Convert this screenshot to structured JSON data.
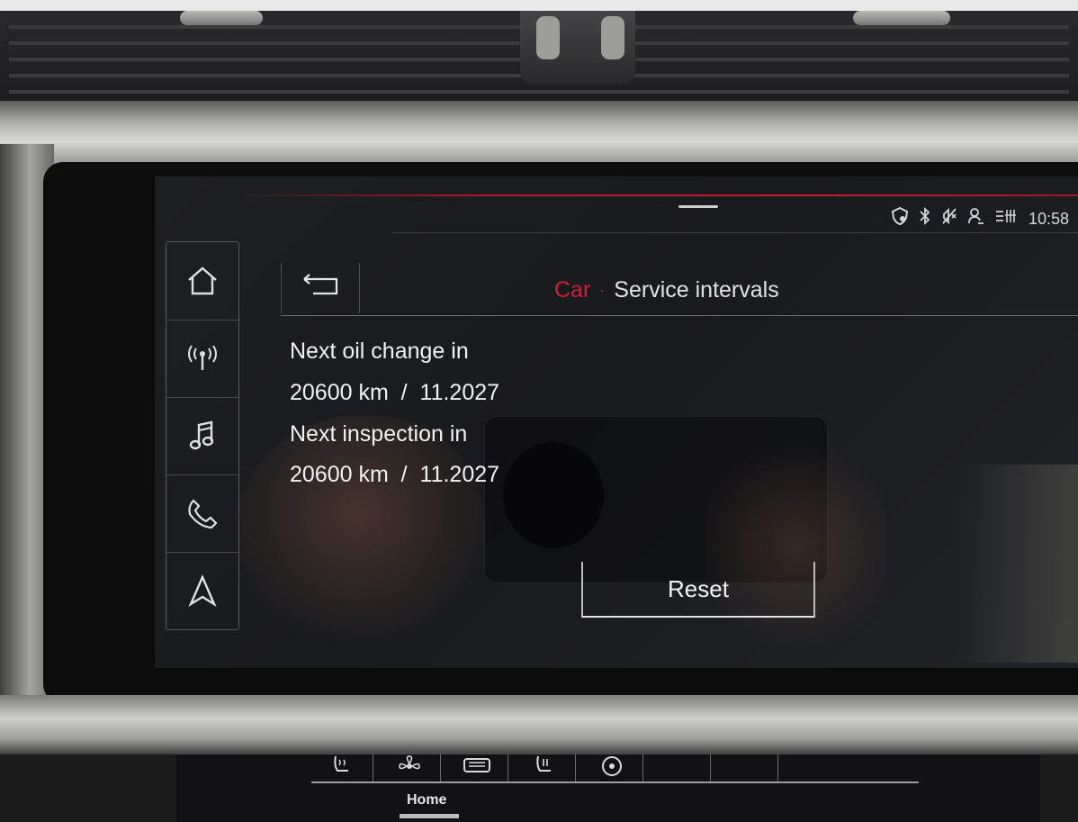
{
  "status_bar": {
    "time": "10:58",
    "icons": [
      "shield-icon",
      "bluetooth-icon",
      "muted-notification-icon",
      "user-profile-icon",
      "signal-settings-icon"
    ]
  },
  "nav_rail": {
    "items": [
      {
        "icon": "home-icon"
      },
      {
        "icon": "radio-antenna-icon"
      },
      {
        "icon": "music-note-icon"
      },
      {
        "icon": "phone-icon"
      },
      {
        "icon": "navigation-arrow-icon"
      }
    ]
  },
  "header": {
    "breadcrumb_parent": "Car",
    "breadcrumb_separator": "·",
    "breadcrumb_current": "Service intervals"
  },
  "service": {
    "oil_change_label": "Next oil change in",
    "oil_change_value": "20600 km  /  11.2027",
    "inspection_label": "Next inspection in",
    "inspection_value": "20600 km  /  11.2027"
  },
  "actions": {
    "reset_label": "Reset"
  },
  "climate_panel": {
    "home_label": "Home"
  },
  "colors": {
    "accent_red": "#d21e36",
    "text_primary": "#f1f1f1"
  }
}
